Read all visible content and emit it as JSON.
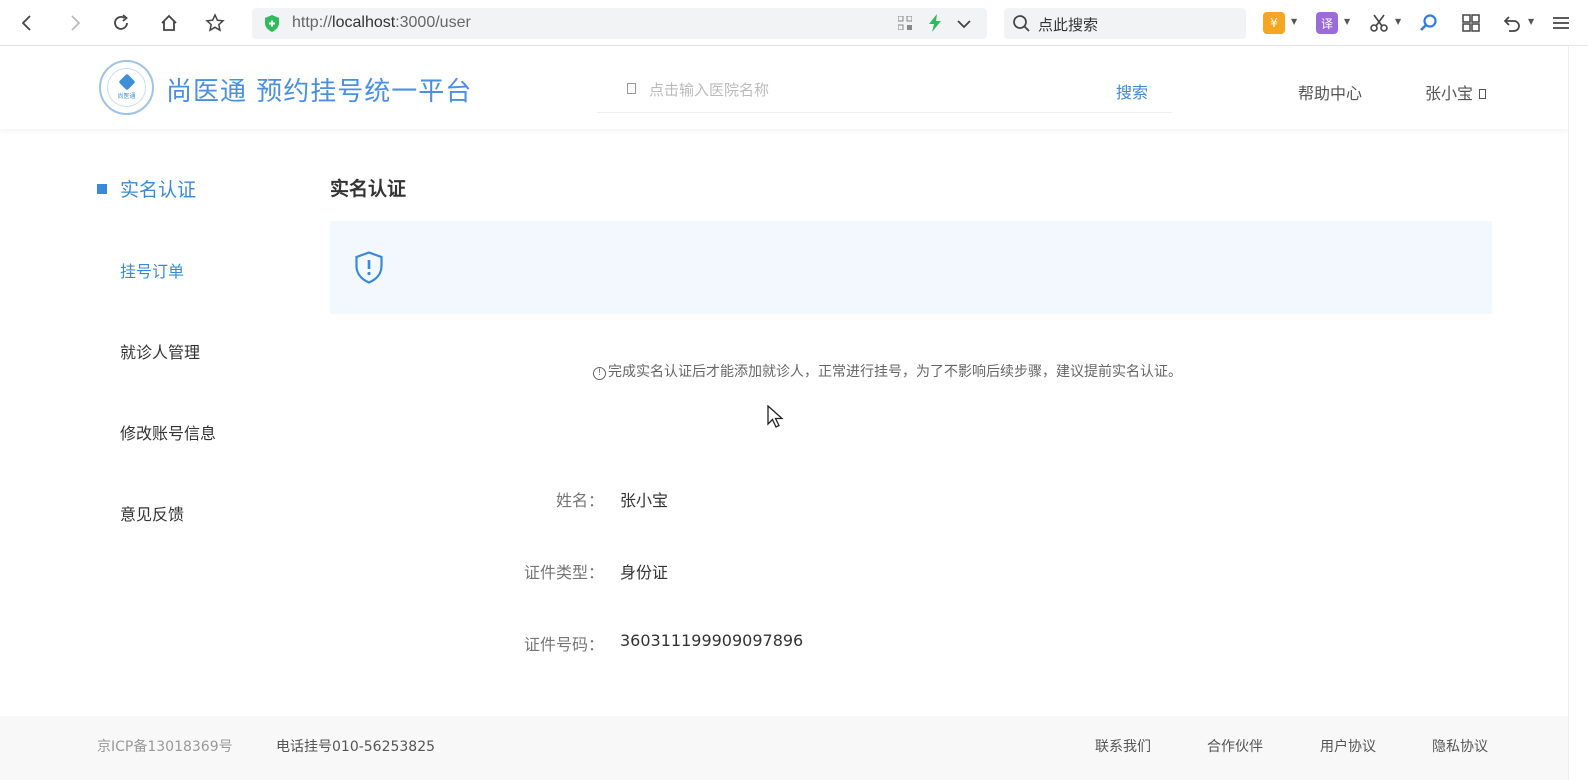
{
  "browser": {
    "url_prefix": "http://",
    "url_host": "localhost",
    "url_rest": ":3000/user",
    "search_placeholder": "点此搜索",
    "ext_translate": "译",
    "ext_shop": "¥"
  },
  "header": {
    "logo_tiny": "尚医通",
    "site_title": "尚医通 预约挂号统一平台",
    "search_placeholder": "点击输入医院名称",
    "search_button": "搜索",
    "help_link": "帮助中心",
    "user_name": "张小宝"
  },
  "sidebar": {
    "active_item": "实名认证",
    "items": [
      {
        "label": "挂号订单",
        "color": "#3a89d8"
      },
      {
        "label": "就诊人管理"
      },
      {
        "label": "修改账号信息"
      },
      {
        "label": "意见反馈"
      }
    ]
  },
  "main": {
    "title": "实名认证",
    "tip_icon": "!",
    "tip": "完成实名认证后才能添加就诊人，正常进行挂号，为了不影响后续步骤，建议提前实名认证。",
    "fields": [
      {
        "label": "姓名：",
        "value": "张小宝"
      },
      {
        "label": "证件类型：",
        "value": "身份证"
      },
      {
        "label": "证件号码：",
        "value": "360311199909097896"
      }
    ]
  },
  "footer": {
    "icp": "京ICP备13018369号",
    "phone": "电话挂号010-56253825",
    "links": [
      "联系我们",
      "合作伙伴",
      "用户协议",
      "隐私协议"
    ]
  },
  "colors": {
    "accent": "#3a89d8",
    "banner_bg": "#f3f8fe"
  }
}
